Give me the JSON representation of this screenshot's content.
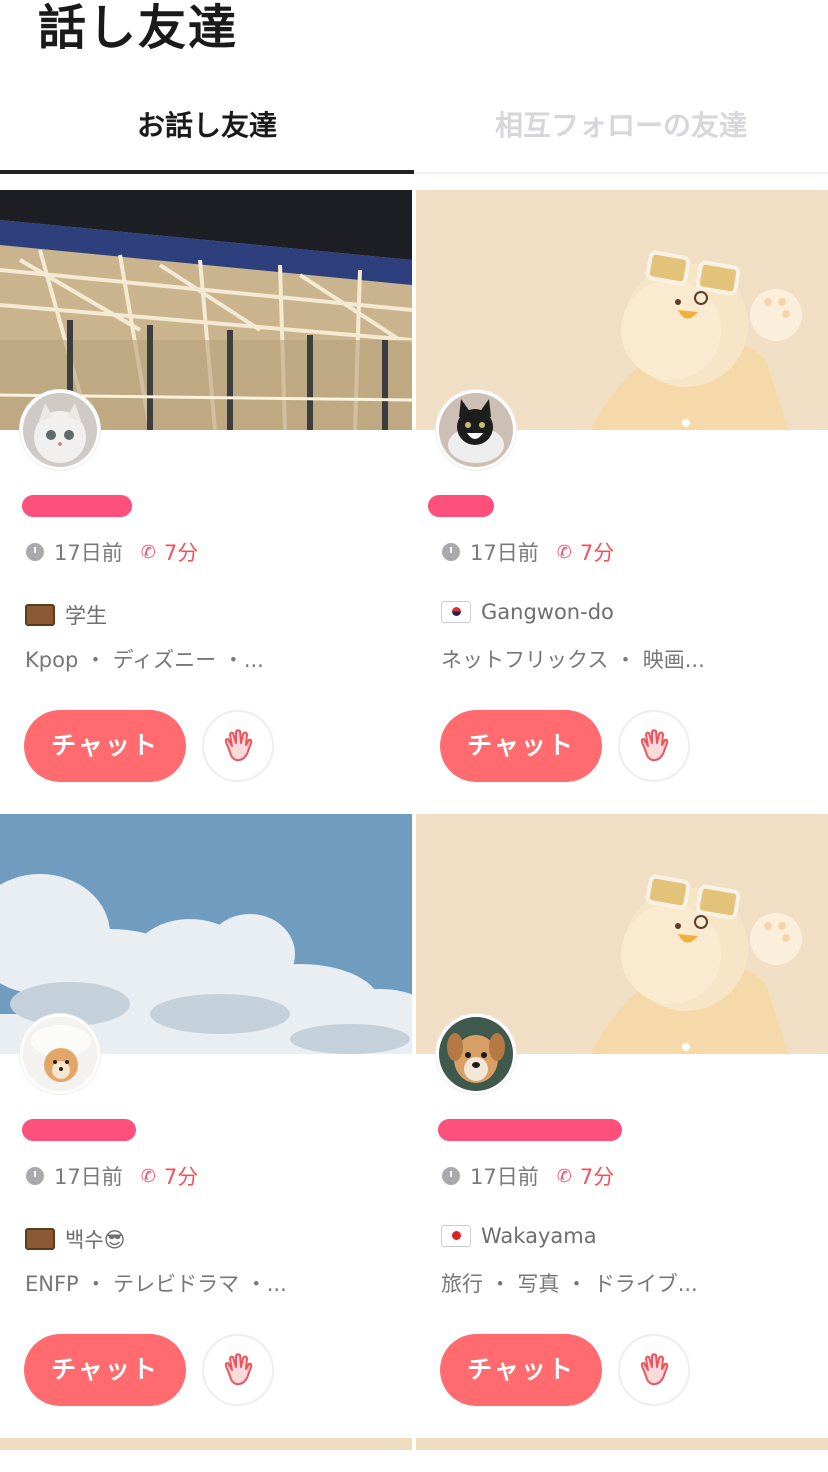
{
  "page": {
    "title": "話し友達"
  },
  "tabs": [
    {
      "label": "お話し友達",
      "active": true
    },
    {
      "label": "相互フォローの友達",
      "active": false
    }
  ],
  "colors": {
    "accent": "#ff6b6f",
    "redaction": "#ff4f7b",
    "call": "#f1535c"
  },
  "cards": [
    {
      "cover": "stadium-roof-photo",
      "avatar": "white-kitten",
      "time": "17日前",
      "call_time": "7分",
      "info_icon": "briefcase-icon",
      "info": "学生",
      "tags": "Kpop ・ ディズニー ・...",
      "chat_label": "チャット",
      "wave_icon": "waving-hand-icon"
    },
    {
      "cover": "mascot-with-glasses",
      "avatar": "tuxedo-cat",
      "time": "17日前",
      "call_time": "7分",
      "info_icon": "korea-flag-icon",
      "info": "Gangwon-do",
      "tags": "ネットフリックス ・ 映画...",
      "chat_label": "チャット",
      "wave_icon": "waving-hand-icon"
    },
    {
      "cover": "clouds-sky-photo",
      "avatar": "pomeranian-puppy",
      "time": "17日前",
      "call_time": "7分",
      "info_icon": "briefcase-icon",
      "info": "백수😎",
      "tags": "ENFP ・ テレビドラマ ・...",
      "chat_label": "チャット",
      "wave_icon": "waving-hand-icon"
    },
    {
      "cover": "mascot-with-glasses",
      "avatar": "brown-puppy",
      "time": "17日前",
      "call_time": "7分",
      "info_icon": "japan-flag-icon",
      "info": "Wakayama",
      "tags": "旅行 ・ 写真 ・ ドライブ...",
      "chat_label": "チャット",
      "wave_icon": "waving-hand-icon"
    }
  ]
}
